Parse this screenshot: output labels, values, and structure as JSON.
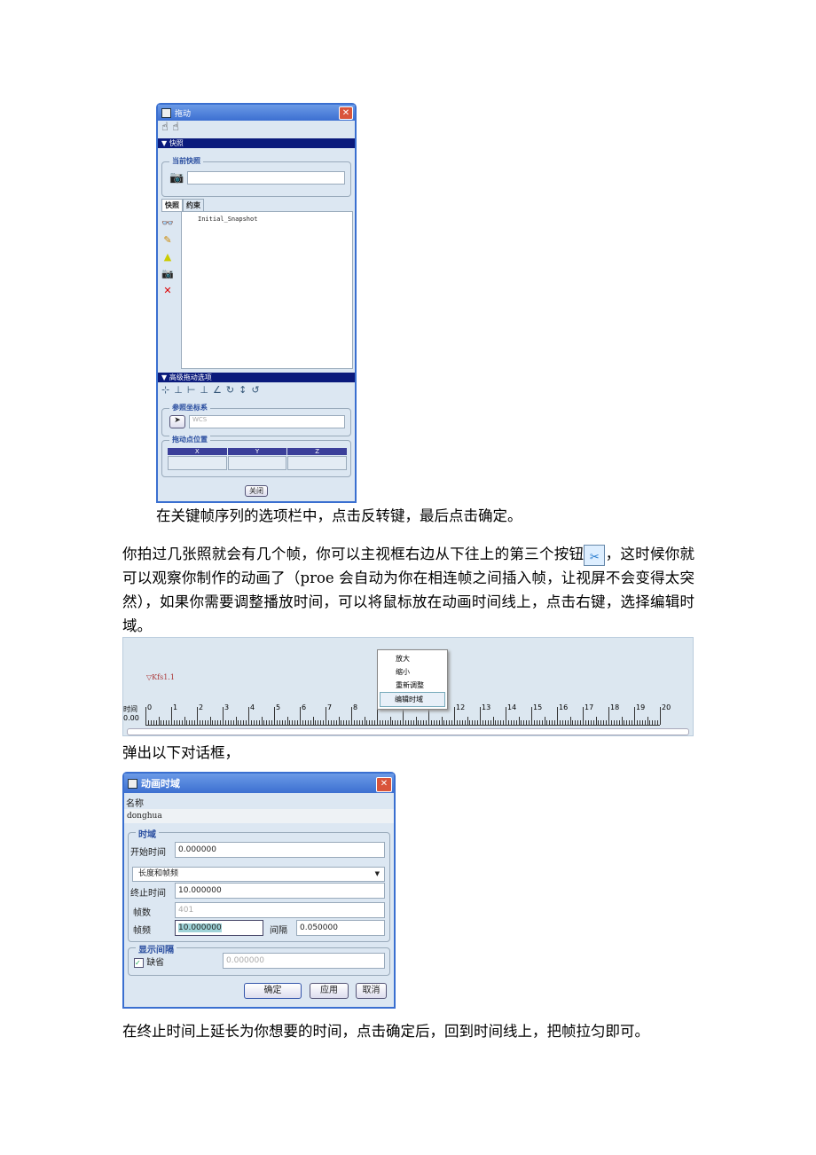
{
  "drag_dialog": {
    "title": "拖动",
    "snapshot_section": "快照",
    "current_snapshot_label": "当前快照",
    "current_snapshot_value": "",
    "tabs": [
      "快照",
      "约束"
    ],
    "snapshots": [
      "Initial_Snapshot"
    ],
    "advanced_section": "高级拖动选项",
    "ref_coord_label": "参照坐标系",
    "ref_coord_value": "WCS",
    "drag_point_label": "拖动点位置",
    "columns": [
      "X",
      "Y",
      "Z"
    ],
    "close_label": "关闭"
  },
  "text": {
    "line1": "在关键帧序列的选项栏中，点击反转键，最后点击确定。",
    "para2a": "你拍过几张照就会有几个帧，你可以主视框右边从下往上的第三个按钮",
    "para2b": "，这时候你就可以观察你制作的动画了（proe 会自动为你在相连帧之间插入帧，让视屏不会变得太突然），如果你需要调整播放时间，可以将鼠标放在动画时间线上，点击右键，选择编辑时域。",
    "popup": "弹出以下对话框，",
    "last": "在终止时间上延长为你想要的时间，点击确定后，回到时间线上，把帧拉匀即可。"
  },
  "timeline": {
    "keyframe_label": "Kfs1.1",
    "time_label": "时间",
    "time_value": "0.00",
    "ticks": [
      "0",
      "1",
      "2",
      "3",
      "4",
      "5",
      "6",
      "7",
      "8",
      "9",
      "10",
      "11",
      "12",
      "13",
      "14",
      "15",
      "16",
      "17",
      "18",
      "19",
      "20"
    ],
    "context_menu": [
      "放大",
      "缩小",
      "重新调整",
      "编辑时域"
    ],
    "selected_menu_item": "编辑时域"
  },
  "time_dialog": {
    "title": "动画时域",
    "name_label": "名称",
    "name_value": "donghua",
    "section_time": "时域",
    "start_label": "开始时间",
    "start_value": "0.000000",
    "mode_value": "长度和帧频",
    "end_label": "终止时间",
    "end_value": "10.000000",
    "frames_label": "帧数",
    "frames_value": "401",
    "rate_label": "帧频",
    "rate_value": "10.000000",
    "interval_label": "间隔",
    "interval_value": "0.050000",
    "section_display": "显示间隔",
    "default_label": "缺省",
    "default_checked": true,
    "display_value": "0.000000",
    "ok_label": "确定",
    "apply_label": "应用",
    "cancel_label": "取消"
  }
}
